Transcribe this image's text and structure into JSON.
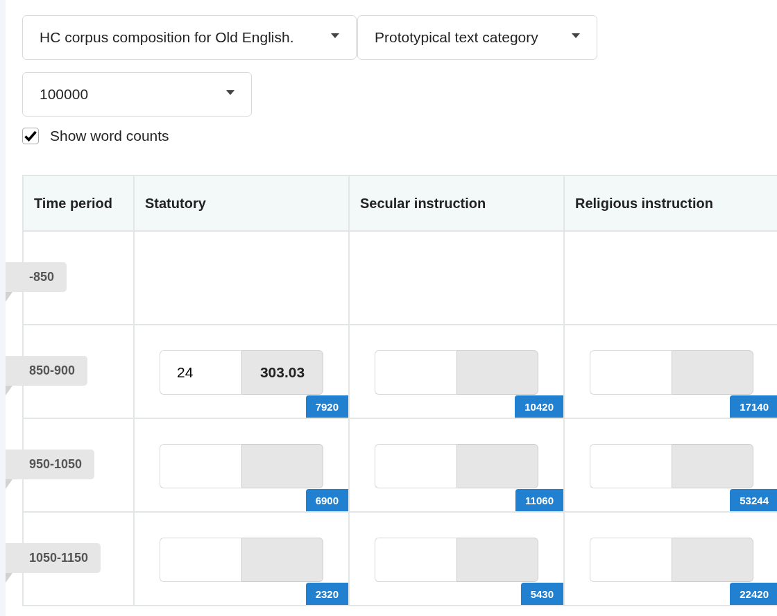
{
  "dropdowns": [
    {
      "value": "HC corpus composition for Old English."
    },
    {
      "value": "Prototypical text category"
    },
    {
      "value": "100000"
    }
  ],
  "show_word_counts": {
    "label": "Show word counts",
    "checked": true
  },
  "table": {
    "columns": [
      "Time period",
      "Statutory",
      "Secular instruction",
      "Religious instruction"
    ],
    "rows": [
      {
        "period": "-850"
      },
      {
        "period": "850-900",
        "cells": [
          {
            "value": "24",
            "rate": "303.03",
            "count": "7920"
          },
          {
            "count": "10420"
          },
          {
            "count": "17140"
          }
        ]
      },
      {
        "period": "950-1050",
        "cells": [
          {
            "count": "6900"
          },
          {
            "count": "11060"
          },
          {
            "count": "53244"
          }
        ]
      },
      {
        "period": "1050-1150",
        "cells": [
          {
            "count": "2320"
          },
          {
            "count": "5430"
          },
          {
            "count": "22420"
          }
        ]
      }
    ]
  }
}
